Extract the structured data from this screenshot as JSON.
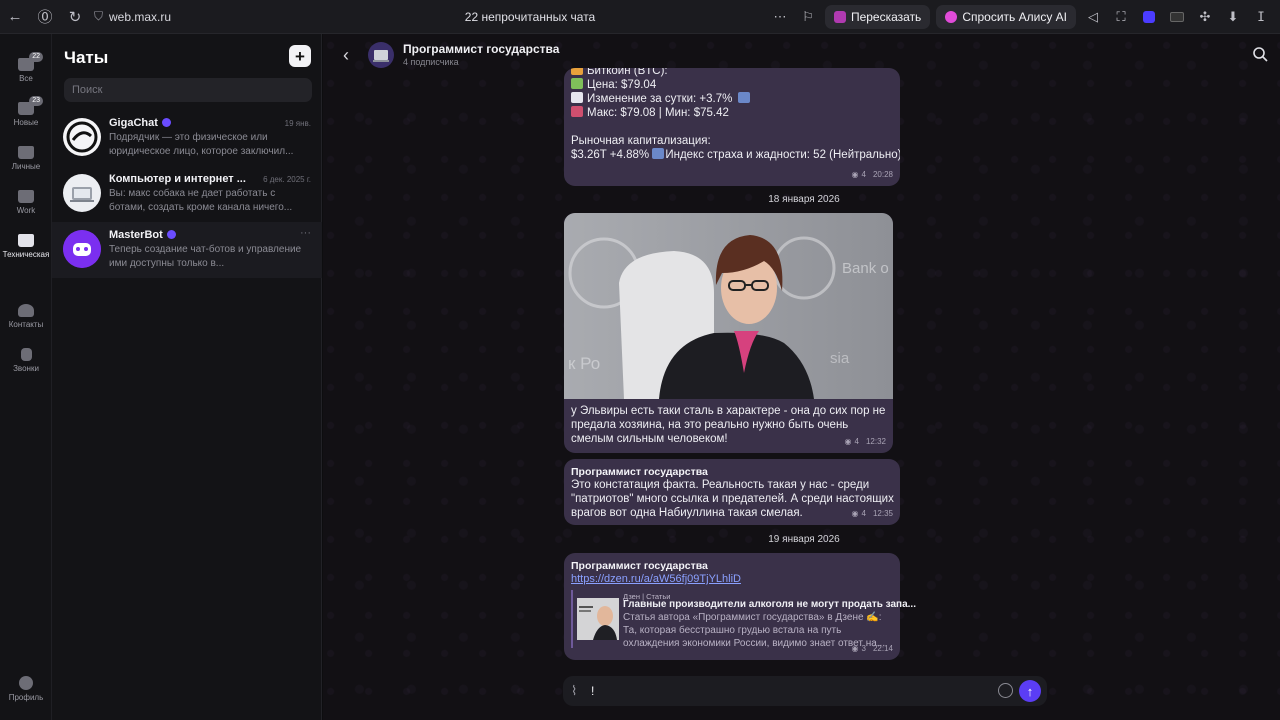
{
  "browser": {
    "url": "web.max.ru",
    "tab_title": "22 непрочитанных чата",
    "retell_label": "Пересказать",
    "ask_alice_label": "Спросить Алису AI"
  },
  "rail": {
    "items": [
      {
        "label": "Все",
        "badge": "22"
      },
      {
        "label": "Новые",
        "badge": "23"
      },
      {
        "label": "Личные"
      },
      {
        "label": "Work"
      },
      {
        "label": "Техническая"
      },
      {
        "label": "Контакты"
      },
      {
        "label": "Звонки"
      },
      {
        "label": "Профиль"
      }
    ]
  },
  "chatlist": {
    "title": "Чаты",
    "search_placeholder": "Поиск",
    "chats": [
      {
        "name": "GigaChat",
        "date": "19 янв.",
        "preview": "Подрядчик — это физическое или юридическое лицо, которое заключил..."
      },
      {
        "name": "Компьютер и интернет ...",
        "date": "6 дек. 2025 г.",
        "preview": "Вы: макс собака не дает работать с ботами, создать кроме канала ничего..."
      },
      {
        "name": "MasterBot",
        "date": "···",
        "preview": "Теперь создание чат-ботов и управление ими доступны только в..."
      }
    ]
  },
  "channel": {
    "title": "Программист государства",
    "subtitle": "4 подписчика"
  },
  "messages": {
    "crypto": {
      "line0": "Биткоин (BTC):",
      "price": "Цена: $79.04",
      "change": "Изменение за сутки: +3.7%",
      "range": "Макс: $79.08 | Мин: $75.42",
      "cap_title": "Рыночная капитализация:",
      "cap_value": "$3.26T +4.88%",
      "fear": "Индекс страха и жадности: 52 (Нейтрально)",
      "views": "4",
      "time": "20:28"
    },
    "date1": "18 января 2026",
    "photo": {
      "bg_text_left": "к Ро",
      "bg_text_right": "Bank o",
      "bg_text_side": "sia",
      "caption": "у Эльвиры есть таки сталь в характере - она до сих пор не предала хозяина, на это реально нужно быть очень смелым сильным человеком!",
      "views": "4",
      "time": "12:32"
    },
    "reply": {
      "sender": "Программист государства",
      "text": "Это констатация факта. Реальность такая у нас - среди \"патриотов\" много ссылка и предателей. А среди настоящих врагов вот одна Набиуллина такая смелая.",
      "views": "4",
      "time": "12:35"
    },
    "date2": "19 января 2026",
    "link_msg": {
      "sender": "Программист государства",
      "url": "https://dzen.ru/a/aW56fj09TjYLhliD",
      "preview_source": "Дзен | Статьи",
      "preview_title": "Главные производители алкоголя не могут продать запа...",
      "preview_desc": "Статья автора «Программист государства» в Дзене ✍: Та, которая бесстрашно грудью встала на путь охлаждения экономики России, видимо знает ответ на...",
      "views": "3",
      "time": "22:14"
    }
  },
  "composer": {
    "value": "!"
  },
  "colors": {
    "accent": "#5b3df5",
    "bubble": "#3a3149",
    "verified": "#6a4cff"
  }
}
